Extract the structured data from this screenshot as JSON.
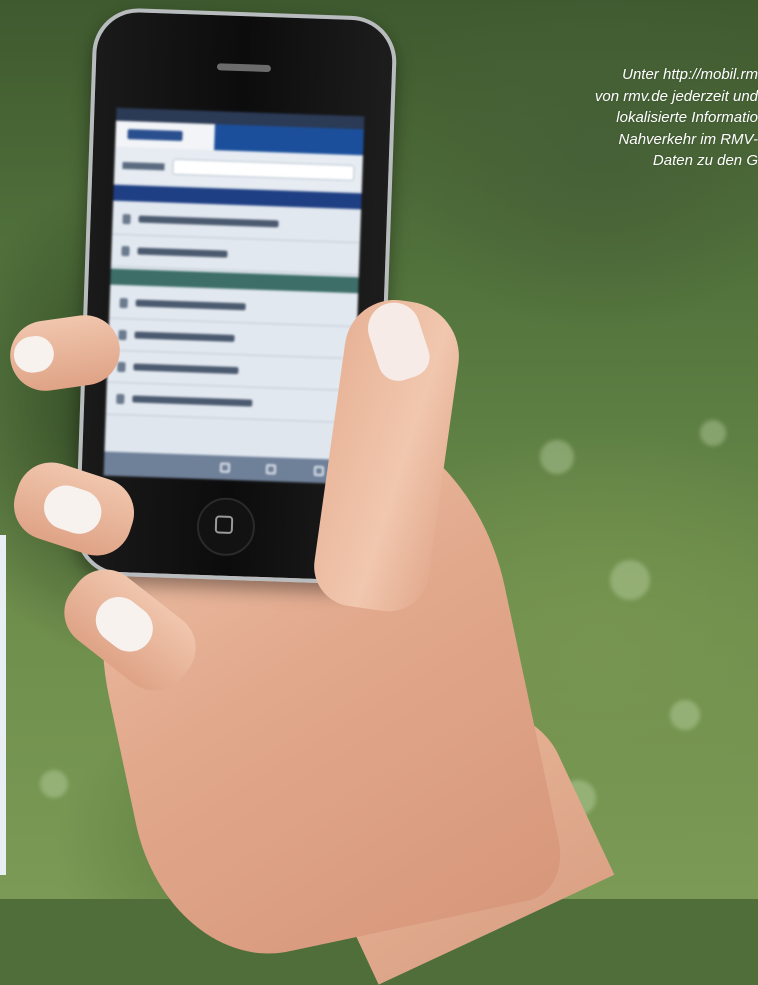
{
  "caption": {
    "lines": [
      "Unter http://mobil.rm",
      "von rmv.de jederzeit und",
      "lokalisierte Informatio",
      "Nahverkehr im RMV-",
      "Daten zu den G"
    ]
  },
  "colors": {
    "caption_text": "#ffffff",
    "phone_frame": "#b9bcbf",
    "screen_header_blue": "#1f3f84",
    "screen_header_teal": "#3d6e68",
    "foliage_green": "#587a40"
  },
  "icons": {
    "home_button": "home-button-icon",
    "toolbar": [
      "add-icon",
      "bookmarks-icon",
      "pages-icon"
    ]
  }
}
